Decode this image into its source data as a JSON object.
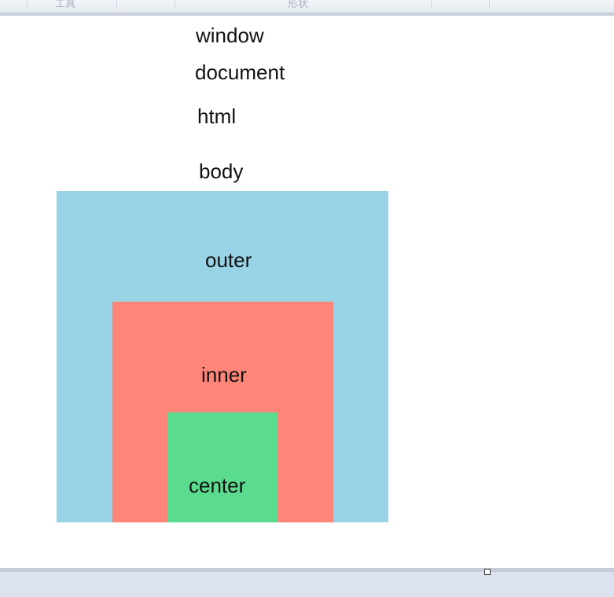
{
  "toolbar": {
    "ghost_left": "工具",
    "ghost_center": "形状"
  },
  "hierarchy": {
    "window": "window",
    "document": "document",
    "html": "html",
    "body": "body"
  },
  "boxes": {
    "outer": {
      "label": "outer",
      "color": "#98d4e6"
    },
    "inner": {
      "label": "inner",
      "color": "#fe8577"
    },
    "center": {
      "label": "center",
      "color": "#5adb8e"
    }
  }
}
